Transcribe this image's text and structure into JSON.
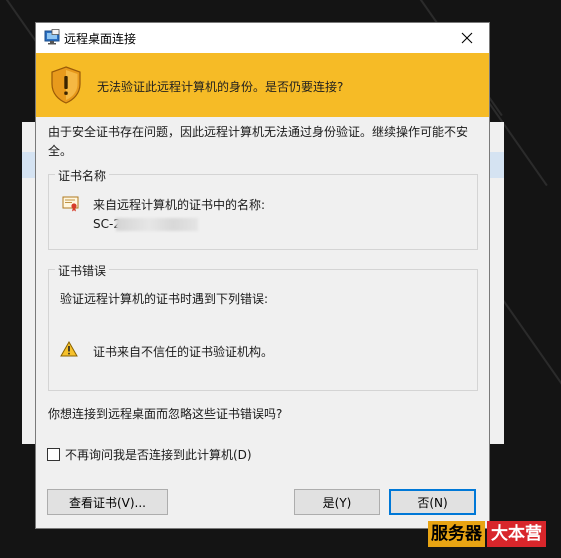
{
  "window": {
    "title": "远程桌面连接",
    "close_icon": "close-icon",
    "app_icon": "remote-desktop-icon"
  },
  "banner": {
    "icon": "shield-warning-icon",
    "text": "无法验证此远程计算机的身份。是否仍要连接?",
    "color": "#f6bb26"
  },
  "description": "由于安全证书存在问题，因此远程计算机无法通过身份验证。继续操作可能不安全。",
  "cert_name_group": {
    "legend": "证书名称",
    "icon": "certificate-icon",
    "label": "来自远程计算机的证书中的名称:",
    "value": "SC-2"
  },
  "cert_error_group": {
    "legend": "证书错误",
    "intro": "验证远程计算机的证书时遇到下列错误:",
    "errors": [
      {
        "icon": "warning-icon",
        "text": "证书来自不信任的证书验证机构。"
      }
    ]
  },
  "question": "你想连接到远程桌面而忽略这些证书错误吗?",
  "checkbox": {
    "label": "不再询问我是否连接到此计算机(D)",
    "checked": false
  },
  "buttons": {
    "view_cert": "查看证书(V)...",
    "yes": "是(Y)",
    "no": "否(N)",
    "focus_color": "#0078d7"
  },
  "watermark": {
    "part1": "服务器",
    "part2": "大本营"
  }
}
